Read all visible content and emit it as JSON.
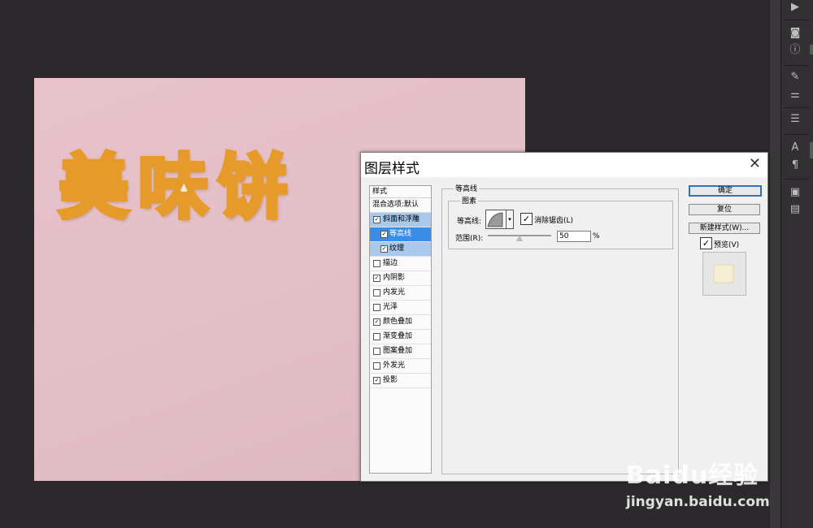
{
  "canvas": {
    "art_text": "美味饼"
  },
  "dialog": {
    "title": "图层样式",
    "styles_header": "样式",
    "blend_options": "混合选项:默认",
    "styles": [
      {
        "label": "斜面和浮雕",
        "checked": true
      },
      {
        "label": "等高线",
        "checked": true
      },
      {
        "label": "纹理",
        "checked": true
      },
      {
        "label": "描边",
        "checked": false
      },
      {
        "label": "内阴影",
        "checked": true
      },
      {
        "label": "内发光",
        "checked": false
      },
      {
        "label": "光泽",
        "checked": false
      },
      {
        "label": "颜色叠加",
        "checked": true
      },
      {
        "label": "渐变叠加",
        "checked": false
      },
      {
        "label": "图案叠加",
        "checked": false
      },
      {
        "label": "外发光",
        "checked": false
      },
      {
        "label": "投影",
        "checked": true
      }
    ],
    "contour_group": "等高线",
    "elements_group": "图素",
    "contour_label": "等高线:",
    "antialias_label": "消除锯齿(L)",
    "range_label": "范围(R):",
    "range_value": "50",
    "range_fraction": 0.5,
    "range_unit": "%",
    "ok": "确定",
    "reset": "复位",
    "new_style": "新建样式(W)...",
    "preview": "预览(V)",
    "check_mark": "✓"
  },
  "watermark": {
    "brand": "Baidu经验",
    "url": "jingyan.baidu.com"
  },
  "icons": [
    "play-icon",
    "layer-comp-icon",
    "info-icon",
    "brush-icon",
    "adjust-icon",
    "align-icon",
    "character-icon",
    "paragraph-icon",
    "swatch-icon",
    "notes-icon"
  ]
}
